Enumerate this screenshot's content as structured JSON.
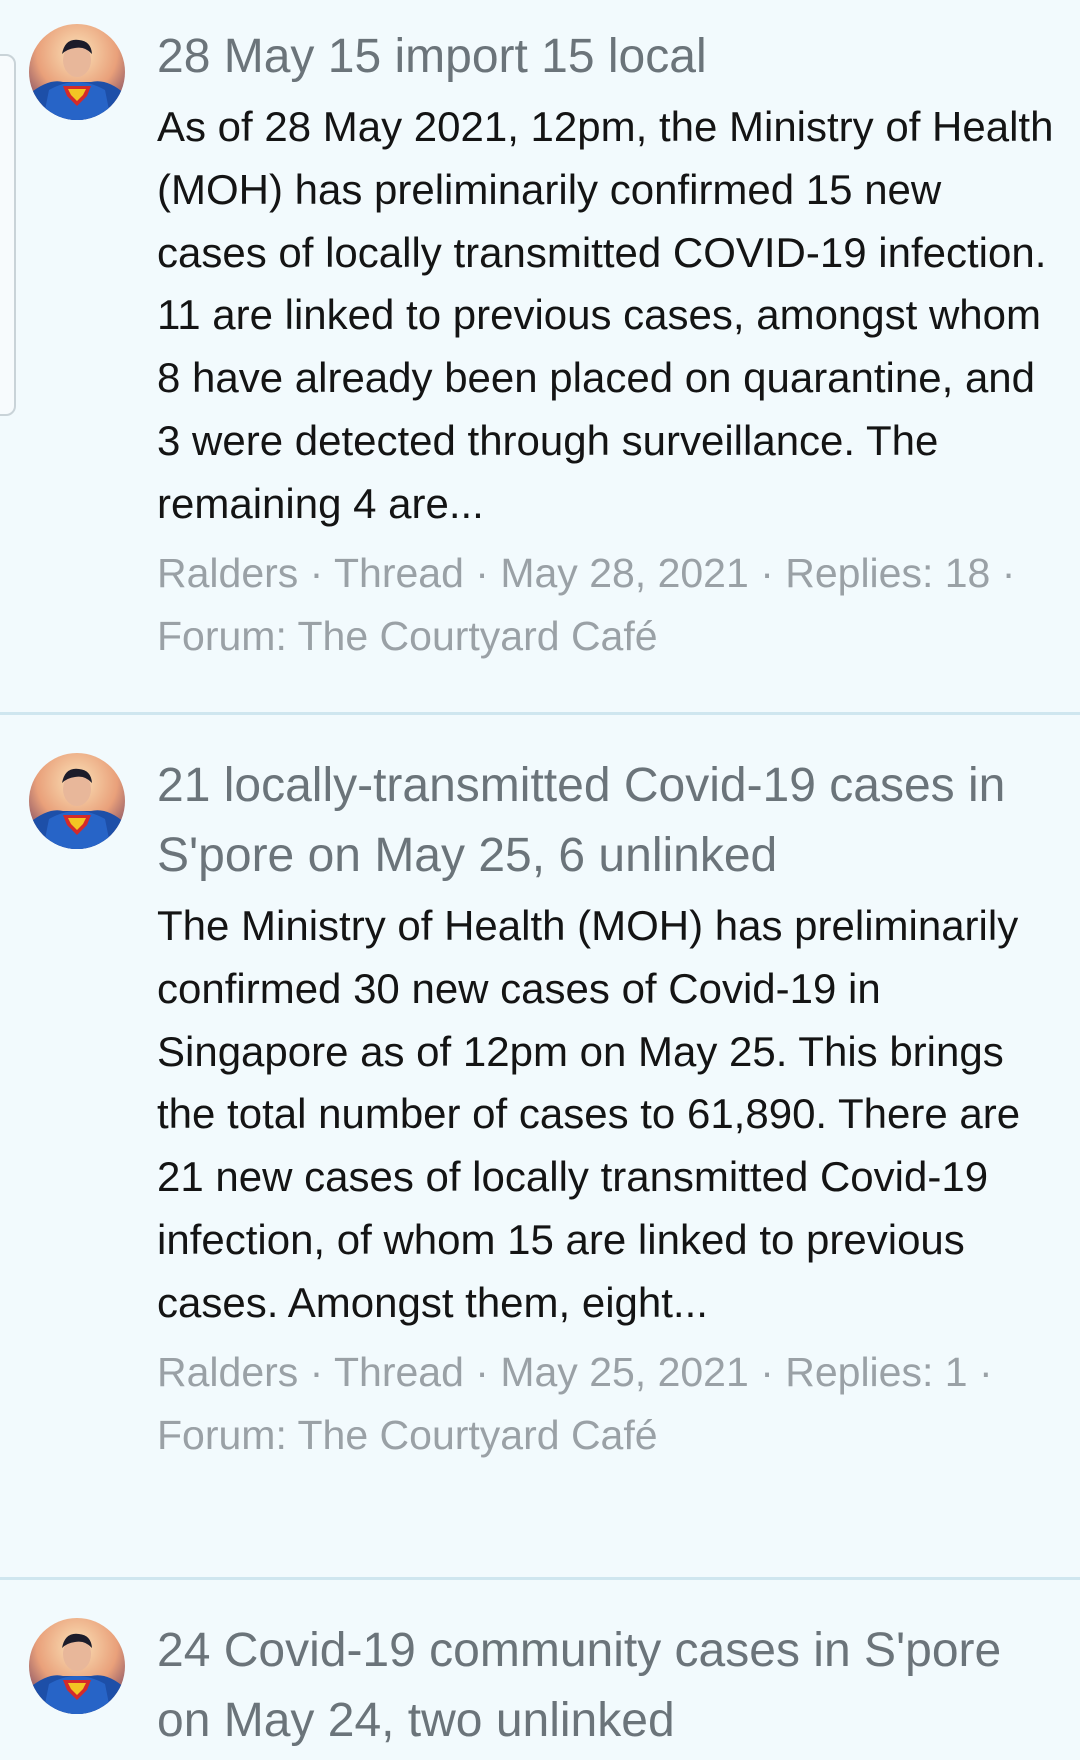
{
  "results": [
    {
      "title": "28 May 15 import 15 local",
      "snippet": "As of 28 May 2021, 12pm, the Ministry of Health (MOH) has preliminarily confirmed 15 new cases of locally transmitted COVID-19 infection. 11 are linked to previous cases, amongst whom 8 have already been placed on quarantine, and 3 were detected through surveillance. The remaining 4 are...",
      "author": "Ralders",
      "type": "Thread",
      "date": "May 28, 2021",
      "replies": "Replies: 18",
      "forum": "Forum: The Courtyard Café",
      "avatar_icon": "superhero-avatar-icon"
    },
    {
      "title": "21 locally-transmitted Covid-19 cases in S'pore on May 25, 6 unlinked",
      "snippet": "The Ministry of Health (MOH) has preliminarily confirmed 30 new cases of Covid-19 in Singapore as of 12pm on May 25. This brings the total number of cases to 61,890. There are 21 new cases of locally transmitted Covid-19 infection, of whom 15 are linked to previous cases. Amongst them, eight...",
      "author": "Ralders",
      "type": "Thread",
      "date": "May 25, 2021",
      "replies": "Replies: 1",
      "forum": "Forum: The Courtyard Café",
      "avatar_icon": "superhero-avatar-icon"
    },
    {
      "title": "24 Covid-19 community cases in S'pore on May 24, two unlinked",
      "avatar_icon": "superhero-avatar-icon"
    }
  ],
  "meta_separator": " · ",
  "colors": {
    "background": "#f2fafd",
    "divider": "#cfe6ef",
    "title": "#6b747a",
    "snippet": "#141414",
    "meta": "#9aa1a6"
  }
}
